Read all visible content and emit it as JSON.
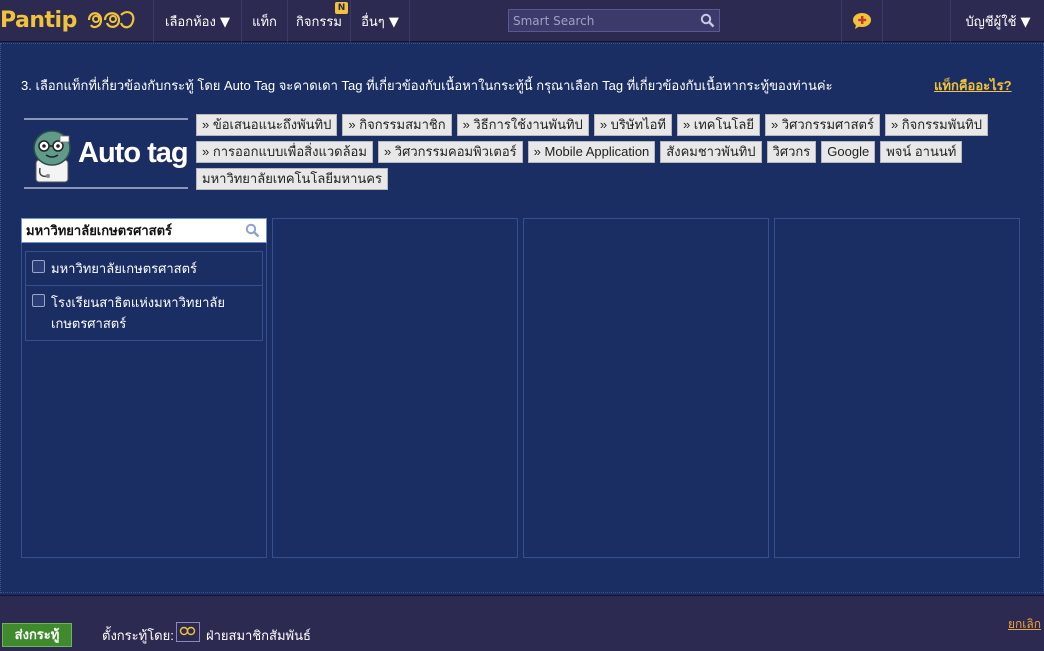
{
  "header": {
    "logo_text": "Pantip",
    "logo_mark": "(ลิง)",
    "nav": [
      {
        "label": "เลือกห้อง ▼"
      },
      {
        "label": "แท็ก"
      },
      {
        "label": "กิจกรรม",
        "badge": "N"
      },
      {
        "label": "อื่นๆ ▼"
      }
    ],
    "search_placeholder": "Smart Search",
    "account_label": "บัญชีผู้ใช้ ▼"
  },
  "autotag_section": {
    "instruction": "3. เลือกแท็กที่เกี่ยวข้องกับกระทู้ โดย Auto Tag จะคาดเดา Tag ที่เกี่ยวข้องกับเนื้อหาในกระทู้นี้ กรุณาเลือก Tag ที่เกี่ยวข้องกับเนื้อหากระทู้ของท่านค่ะ",
    "whatis_link": "แท็กคืออะไร?",
    "logo_label": "Auto tag",
    "tags": [
      "» ข้อเสนอแนะถึงพันทิป",
      "» กิจกรรมสมาชิก",
      "» วิธีการใช้งานพันทิป",
      "» บริษัทไอที",
      "» เทคโนโลยี",
      "» วิศวกรรมศาสตร์",
      "» กิจกรรมพันทิป",
      "» การออกแบบเพื่อสิ่งแวดล้อม",
      "» วิศวกรรมคอมพิวเตอร์",
      "» Mobile Application",
      "สังคมชาวพันทิป",
      "วิศวกร",
      "Google",
      "พจน์ อานนท์",
      "มหาวิทยาลัยเทคโนโลยีมหานคร"
    ]
  },
  "tag_search": {
    "value": "มหาวิทยาลัยเกษตรศาสตร์",
    "results": [
      {
        "label": "มหาวิทยาลัยเกษตรศาสตร์",
        "checked": false
      },
      {
        "label": "โรงเรียนสาธิตแห่งมหาวิทยาลัย\nเกษตรศาสตร์",
        "checked": false
      }
    ]
  },
  "footer": {
    "submit_label": "ส่งกระทู้",
    "posted_by_label": "ตั้งกระทู้โดย:",
    "avatar_text": "Pantip",
    "username": "ฝ่ายสมาชิกสัมพันธ์",
    "cancel_label": "ยกเลิก"
  },
  "colors": {
    "background": "#1b2e63",
    "header": "#2c2a50",
    "brand_yellow": "#f1c23b",
    "submit_green": "#3e8a2c"
  }
}
